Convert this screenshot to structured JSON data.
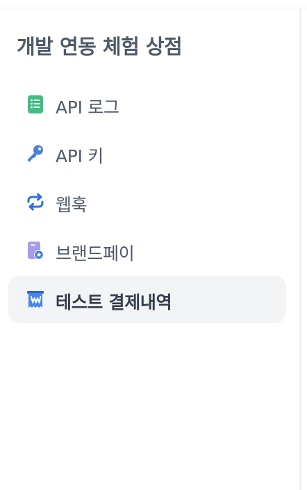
{
  "sidebar": {
    "title": "개발 연동 체험 상점",
    "items": [
      {
        "label": "API 로그",
        "icon": "log-document-icon",
        "color": "#3fbf7f",
        "active": false
      },
      {
        "label": "API 키",
        "icon": "key-icon",
        "color": "#4f7fd9",
        "active": false
      },
      {
        "label": "웹훅",
        "icon": "refresh-arrows-icon",
        "color": "#2f6fe0",
        "active": false
      },
      {
        "label": "브랜드페이",
        "icon": "brand-card-icon",
        "color": "#9a8ae0",
        "active": false
      },
      {
        "label": "테스트 결제내역",
        "icon": "won-receipt-icon",
        "color": "#3f7ae0",
        "active": true
      }
    ]
  },
  "colors": {
    "active_background": "#f2f4f6",
    "text": "#4e5968",
    "text_active": "#333d4b"
  }
}
